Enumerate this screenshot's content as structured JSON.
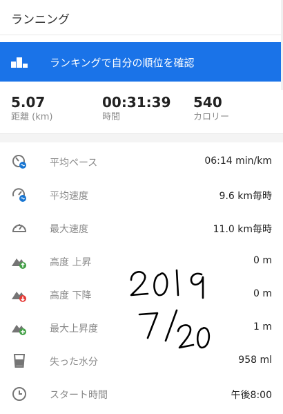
{
  "header": {
    "title": "ランニング"
  },
  "ranking": {
    "label": "ランキングで自分の順位を確認"
  },
  "summary": [
    {
      "value": "5.07",
      "label": "距離 (km)"
    },
    {
      "value": "00:31:39",
      "label": "時間"
    },
    {
      "value": "540",
      "label": "カロリー"
    }
  ],
  "details": [
    {
      "icon": "pace-gauge-icon",
      "label": "平均ペース",
      "value": "06:14 min/km"
    },
    {
      "icon": "speed-gauge-icon",
      "label": "平均速度",
      "value": "9.6 km毎時"
    },
    {
      "icon": "speedometer-icon",
      "label": "最大速度",
      "value": "11.0 km毎時"
    },
    {
      "icon": "elevation-gain-icon",
      "label": "高度 上昇",
      "value": "0 m"
    },
    {
      "icon": "elevation-loss-icon",
      "label": "高度 下降",
      "value": "0 m"
    },
    {
      "icon": "max-elevation-icon",
      "label": "最大上昇度",
      "value": "1 m"
    },
    {
      "icon": "water-glass-icon",
      "label": "失った水分",
      "value": "958 ml"
    },
    {
      "icon": "clock-icon",
      "label": "スタート時間",
      "value": "午後8:00"
    }
  ],
  "handwritten_note": {
    "line1": "2019",
    "line2": "7/20"
  },
  "colors": {
    "accent": "#1a73e8",
    "icon_blue": "#1976d2",
    "icon_green": "#43a047",
    "icon_red": "#e53935",
    "icon_gray": "#757575"
  }
}
